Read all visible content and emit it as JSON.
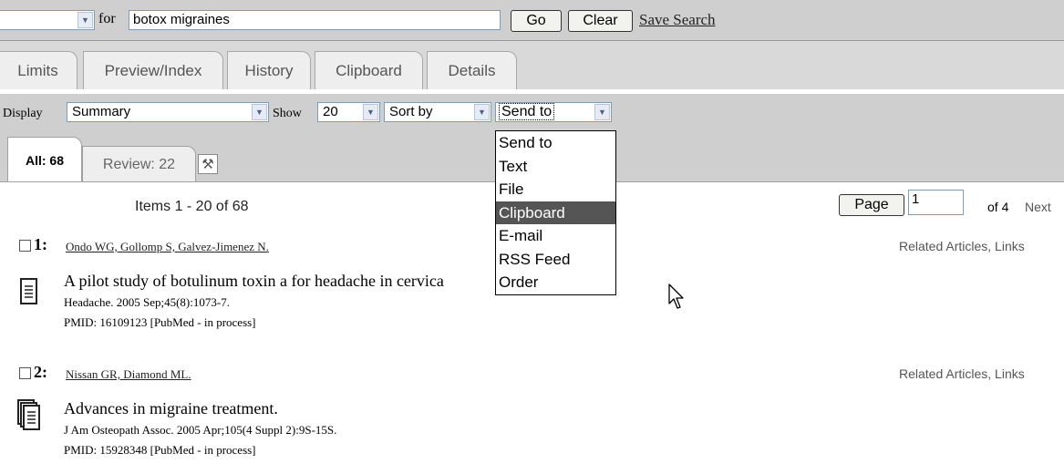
{
  "search": {
    "for_label": "for",
    "query": "botox migraines",
    "go_label": "Go",
    "clear_label": "Clear",
    "save_search_label": "Save Search"
  },
  "tabs": [
    {
      "label": "Limits"
    },
    {
      "label": "Preview/Index"
    },
    {
      "label": "History"
    },
    {
      "label": "Clipboard"
    },
    {
      "label": "Details"
    }
  ],
  "display_bar": {
    "display_label": "Display",
    "display_value": "Summary",
    "show_label": "Show",
    "show_value": "20",
    "sort_value": "Sort by",
    "send_value": "Send to"
  },
  "send_to_menu": [
    "Send to",
    "Text",
    "File",
    "Clipboard",
    "E-mail",
    "RSS Feed",
    "Order"
  ],
  "send_to_highlighted": "Clipboard",
  "subtabs": {
    "all": "All: 68",
    "review": "Review: 22"
  },
  "pagination": {
    "items": "Items 1 - 20 of 68",
    "page_label": "Page",
    "page_value": "1",
    "of_label": "of 4",
    "next_label": "Next"
  },
  "results": [
    {
      "number": "1:",
      "authors": "Ondo WG, Gollomp S, Galvez-Jimenez N.",
      "related": "Related Articles, Links",
      "title": "A pilot study of botulinum toxin a for headache in cervica",
      "citation": "Headache. 2005 Sep;45(8):1073-7.",
      "pmid": "PMID: 16109123 [PubMed - in process]"
    },
    {
      "number": "2:",
      "authors": "Nissan GR, Diamond ML.",
      "related": "Related Articles, Links",
      "title": "Advances in migraine treatment.",
      "citation": "J Am Osteopath Assoc. 2005 Apr;105(4 Suppl 2):9S-15S.",
      "pmid": "PMID: 15928348 [PubMed - in process]"
    }
  ],
  "colors": {
    "bar_gray": "#cfcfcf",
    "tab_gray": "#eeeeee",
    "menu_highlight": "#555555"
  }
}
